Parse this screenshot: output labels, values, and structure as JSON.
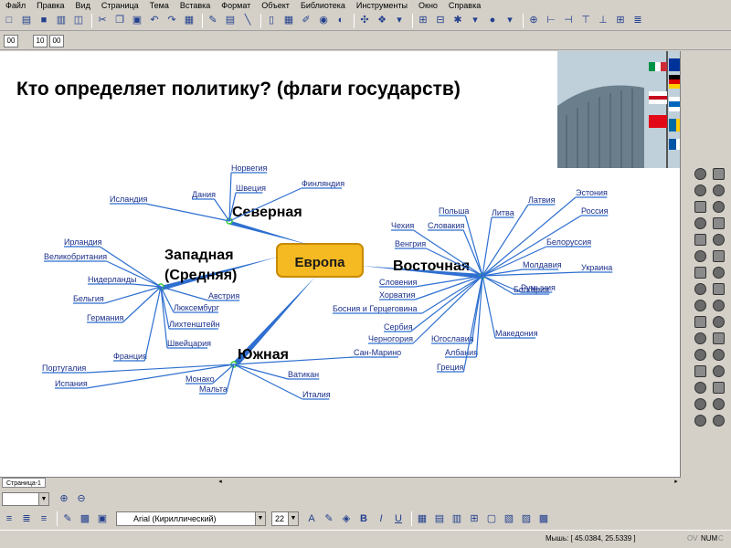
{
  "menu": [
    "Файл",
    "Правка",
    "Вид",
    "Страница",
    "Тема",
    "Вставка",
    "Формат",
    "Объект",
    "Библиотека",
    "Инструменты",
    "Окно",
    "Справка"
  ],
  "timer": [
    "00",
    "10",
    "00"
  ],
  "slide": {
    "title": "Кто определяет политику? (флаги государств)"
  },
  "mindmap": {
    "center": "Европа",
    "branches": {
      "north": "Северная",
      "west": "Западная\n(Средняя)",
      "west_line1": "Западная",
      "west_line2": "(Средняя)",
      "east": "Восточная",
      "south": "Южная"
    },
    "north_items": [
      "Норвегия",
      "Дания",
      "Швеция",
      "Финляндия",
      "Исландия"
    ],
    "west_items": [
      "Ирландия",
      "Великобритания",
      "Нидерланды",
      "Бельгия",
      "Германия",
      "Франция",
      "Австрия",
      "Люксембург",
      "Лихтенштейн",
      "Швейцария"
    ],
    "east_items": [
      "Польша",
      "Латвия",
      "Эстония",
      "Чехия",
      "Словакия",
      "Литва",
      "Россия",
      "Венгрия",
      "Белоруссия",
      "Молдавия",
      "Украина",
      "Словения",
      "Хорватия",
      "Босния и Герцеговина",
      "Румыния",
      "Болгария",
      "Сербия",
      "Македония",
      "Черногория",
      "Югославия",
      "Албания",
      "Греция"
    ],
    "south_items": [
      "Сан-Марино",
      "Португалия",
      "Испания",
      "Монако",
      "Мальта",
      "Ватикан",
      "Италия"
    ]
  },
  "page_tab": "Страница-1",
  "font": {
    "name": "Arial (Кириллический)",
    "size": "22"
  },
  "status": {
    "mouse": "Мышь: [ 45.0384, 25.5339 ]",
    "ovr": "OV",
    "num": "NUM",
    "caps": "C"
  },
  "colors": {
    "branch_line": "#2e6fd0",
    "node_label": "#1a2f8a",
    "center_fill": "#f5b921",
    "center_border": "#c88a00",
    "connector": "#33cc33"
  }
}
